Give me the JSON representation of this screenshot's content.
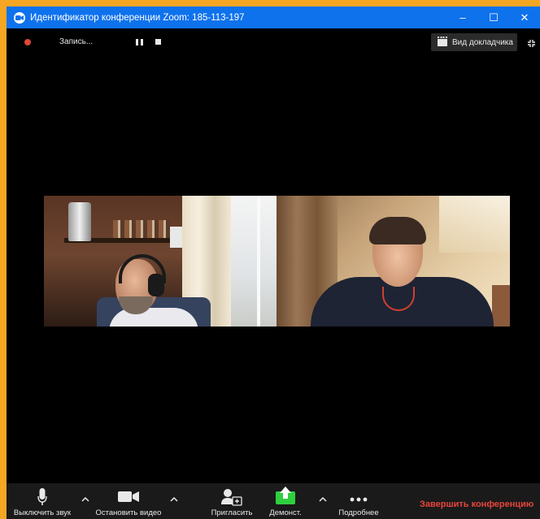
{
  "window": {
    "title": "Идентификатор конференции Zoom: 185-113-197",
    "controls": {
      "minimize": "–",
      "maximize": "☐",
      "close": "✕"
    }
  },
  "recording": {
    "label": "Запись..."
  },
  "view": {
    "speaker_view_label": "Вид докладчика"
  },
  "toolbar": {
    "mute_label": "Выключить звук",
    "video_label": "Остановить видео",
    "invite_label": "Пригласить",
    "share_label": "Демонст.",
    "more_label": "Подробнее",
    "end_label": "Завершить конференцию"
  },
  "colors": {
    "titlebar": "#0e72ed",
    "share_green": "#2fcf3f",
    "end_red": "#e8453c",
    "frame_orange": "#f5a623"
  },
  "participants": [
    {
      "tile": "left",
      "description_icon": "participant-video"
    },
    {
      "tile": "right",
      "description_icon": "participant-video"
    }
  ]
}
